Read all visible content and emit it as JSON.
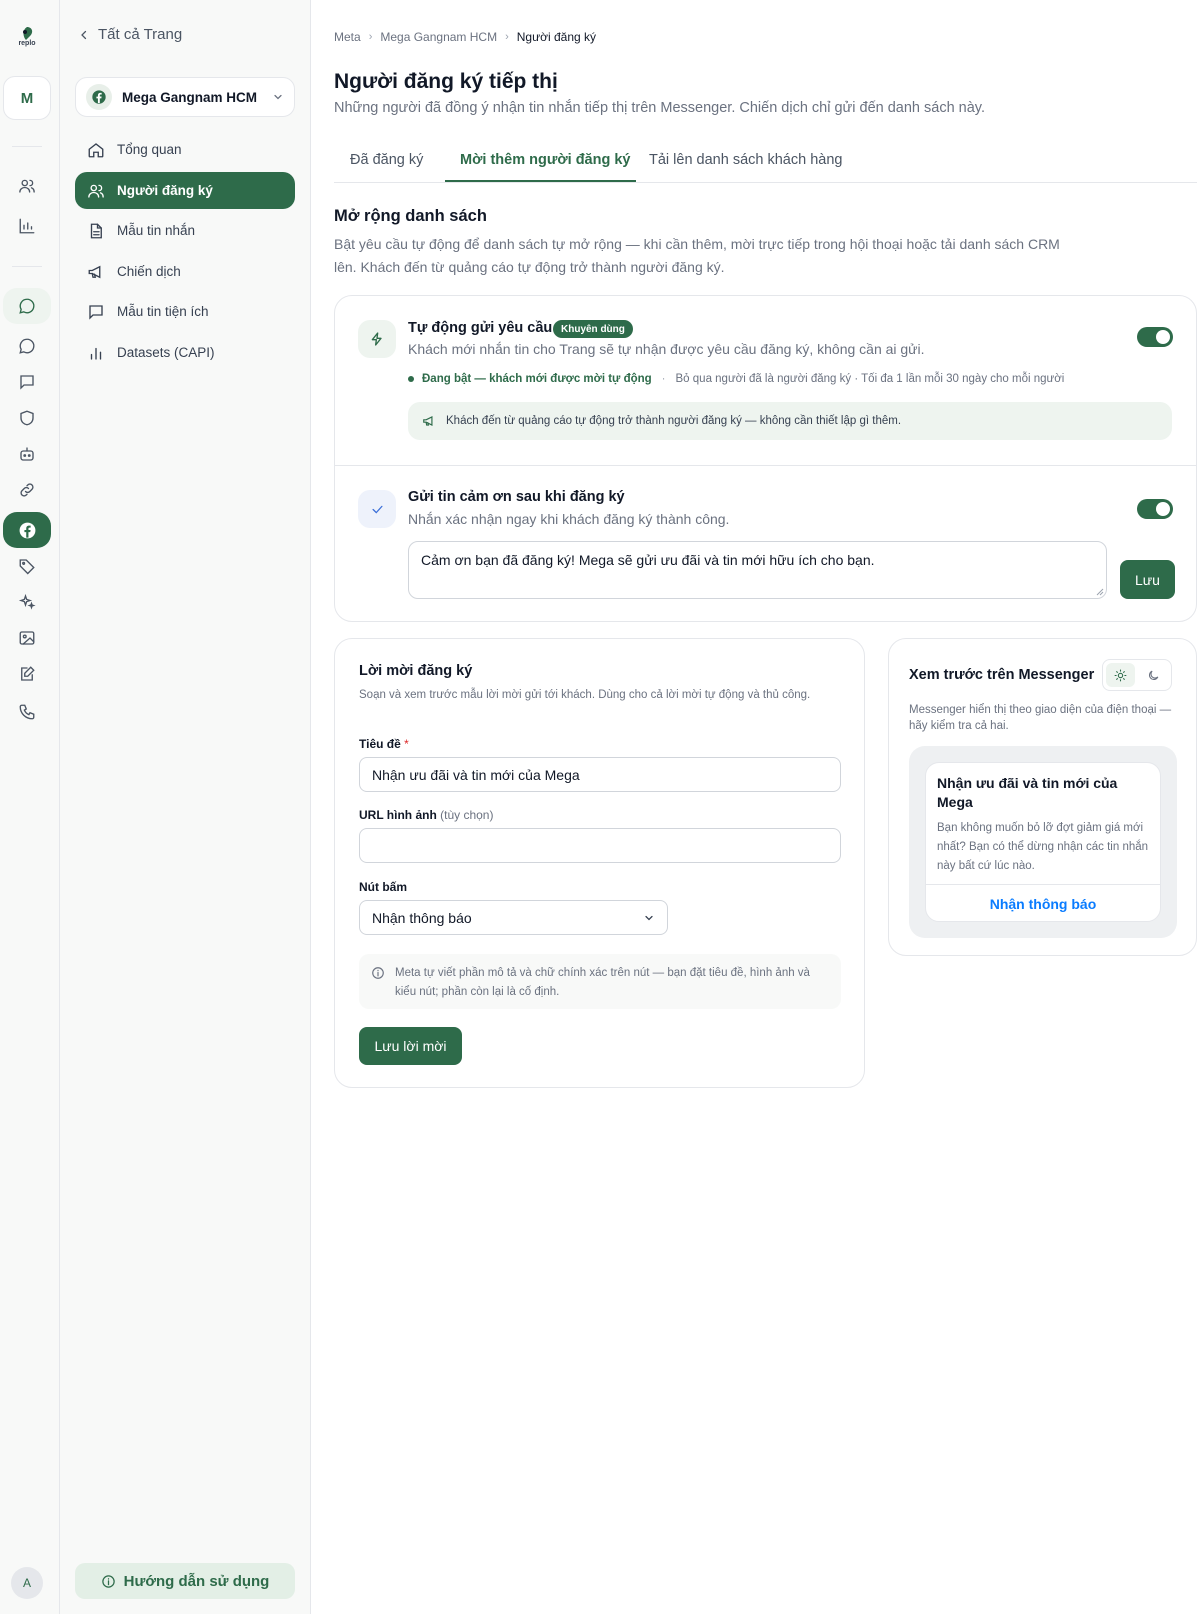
{
  "rail": {
    "logo_text": "replo",
    "workspace_initial": "M",
    "user_initial": "A"
  },
  "nav": {
    "back_label": "Tất cả Trang",
    "page_name": "Mega Gangnam HCM",
    "items": [
      {
        "label": "Tổng quan",
        "icon": "home-icon"
      },
      {
        "label": "Người đăng ký",
        "icon": "users-icon",
        "active": true
      },
      {
        "label": "Mẫu tin nhắn",
        "icon": "document-icon"
      },
      {
        "label": "Chiến dịch",
        "icon": "megaphone-icon"
      },
      {
        "label": "Mẫu tin tiện ích",
        "icon": "message-square-icon"
      },
      {
        "label": "Datasets (CAPI)",
        "icon": "bar-chart-icon"
      }
    ],
    "help_label": "Hướng dẫn sử dụng"
  },
  "breadcrumb": [
    "Meta",
    "Mega Gangnam HCM",
    "Người đăng ký"
  ],
  "page": {
    "title": "Người đăng ký tiếp thị",
    "subtitle": "Những người đã đồng ý nhận tin nhắn tiếp thị trên Messenger. Chiến dịch chỉ gửi đến danh sách này."
  },
  "tabs": [
    {
      "label": "Đã đăng ký"
    },
    {
      "label": "Mời thêm người đăng ký",
      "active": true
    },
    {
      "label": "Tải lên danh sách khách hàng"
    }
  ],
  "expand": {
    "title": "Mở rộng danh sách",
    "description": "Bật yêu cầu tự động để danh sách tự mở rộng — khi cần thêm, mời trực tiếp trong hội thoại hoặc tải danh sách CRM lên. Khách đến từ quảng cáo tự động trở thành người đăng ký."
  },
  "auto_request": {
    "title": "Tự động gửi yêu cầu",
    "badge": "Khuyên dùng",
    "description": "Khách mới nhắn tin cho Trang sẽ tự nhận được yêu cầu đăng ký, không cần ai gửi.",
    "enabled": true,
    "status_on": "Đang bật — khách mới được mời tự động",
    "status_rules": "Bỏ qua người đã là người đăng ký · Tối đa 1 lần mỗi 30 ngày cho mỗi người",
    "ad_info": "Khách đến từ quảng cáo tự động trở thành người đăng ký — không cần thiết lập gì thêm."
  },
  "thank_you": {
    "title": "Gửi tin cảm ơn sau khi đăng ký",
    "description": "Nhắn xác nhận ngay khi khách đăng ký thành công.",
    "enabled": true,
    "message": "Cảm ơn bạn đã đăng ký! Mega sẽ gửi ưu đãi và tin mới hữu ích cho bạn.",
    "save_label": "Lưu"
  },
  "invite": {
    "title": "Lời mời đăng ký",
    "description": "Soạn và xem trước mẫu lời mời gửi tới khách. Dùng cho cả lời mời tự động và thủ công.",
    "title_label": "Tiêu đề",
    "required_mark": "*",
    "title_value": "Nhận ưu đãi và tin mới của Mega",
    "image_label": "URL hình ảnh",
    "image_optional": "(tùy chọn)",
    "image_value": "",
    "button_label": "Nút bấm",
    "button_value": "Nhận thông báo",
    "note": "Meta tự viết phần mô tả và chữ chính xác trên nút — bạn đặt tiêu đề, hình ảnh và kiểu nút; phần còn lại là cố định.",
    "save_label": "Lưu lời mời"
  },
  "preview": {
    "title": "Xem trước trên Messenger",
    "theme_selected": "light",
    "description": "Messenger hiển thị theo giao diện của điện thoại — hãy kiểm tra cả hai.",
    "bubble_title": "Nhận ưu đãi và tin mới của Mega",
    "bubble_body": "Bạn không muốn bỏ lỡ đợt giảm giá mới nhất? Bạn có thể dừng nhận các tin nhắn này bất cứ lúc nào.",
    "bubble_button": "Nhận thông báo"
  },
  "colors": {
    "accent": "#2e6b4a",
    "accent_soft": "#eef4ef",
    "messenger_link": "#0a7cff"
  }
}
